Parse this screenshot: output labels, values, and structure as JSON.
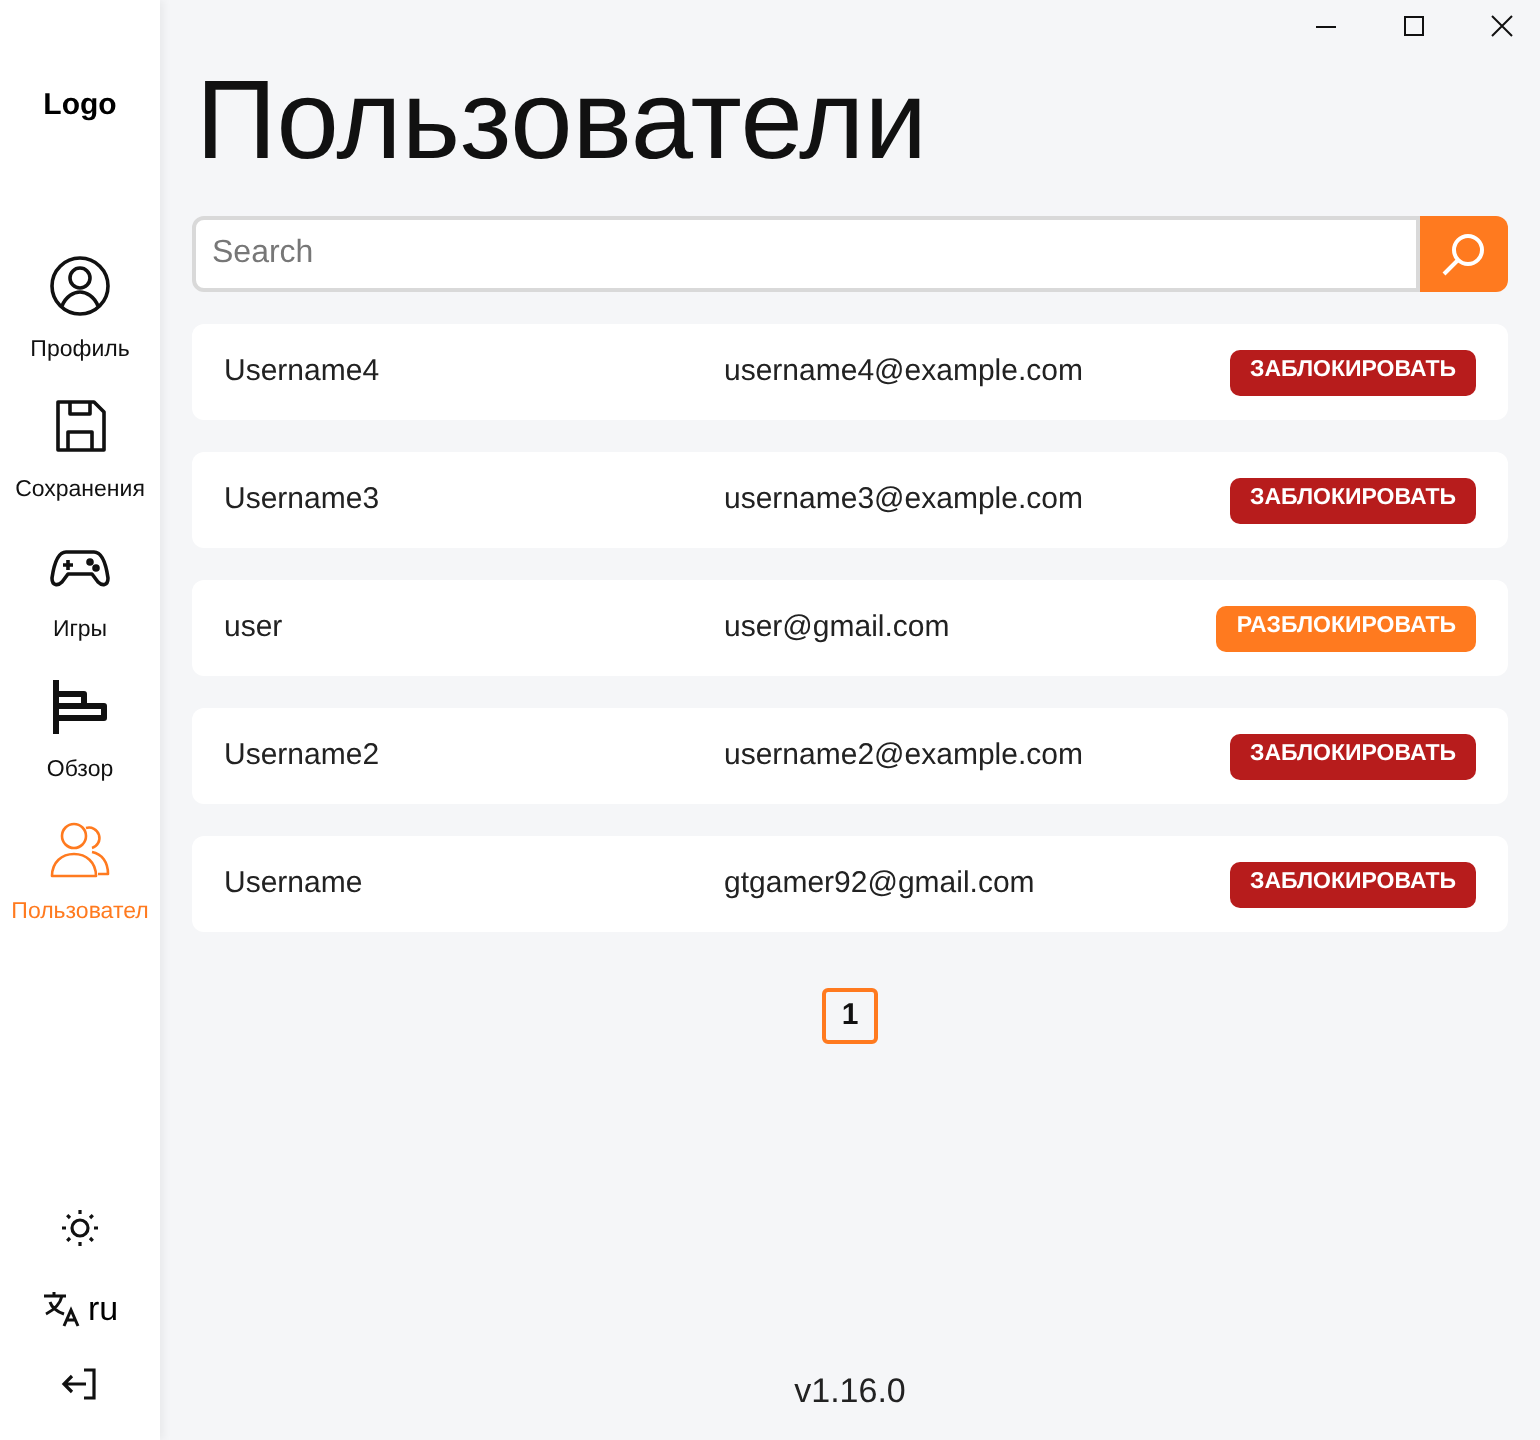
{
  "sidebar": {
    "logo": "Logo",
    "items": [
      {
        "kind": "profile",
        "label": "Профиль",
        "selected": false
      },
      {
        "kind": "saves",
        "label": "Сохранения",
        "selected": false
      },
      {
        "kind": "games",
        "label": "Игры",
        "selected": false
      },
      {
        "kind": "overview",
        "label": "Обзор",
        "selected": false
      },
      {
        "kind": "users",
        "label": "Пользовател",
        "selected": true
      }
    ],
    "language": "ru"
  },
  "title": "Пользователи",
  "search": {
    "placeholder": "Search"
  },
  "users": [
    {
      "username": "Username4",
      "email": "username4@example.com",
      "blocked": false,
      "action": "ЗАБЛОКИРОВАТЬ"
    },
    {
      "username": "Username3",
      "email": "username3@example.com",
      "blocked": false,
      "action": "ЗАБЛОКИРОВАТЬ"
    },
    {
      "username": "user",
      "email": "user@gmail.com",
      "blocked": true,
      "action": "РАЗБЛОКИРОВАТЬ"
    },
    {
      "username": "Username2",
      "email": "username2@example.com",
      "blocked": false,
      "action": "ЗАБЛОКИРОВАТЬ"
    },
    {
      "username": "Username",
      "email": "gtgamer92@gmail.com",
      "blocked": false,
      "action": "ЗАБЛОКИРОВАТЬ"
    }
  ],
  "pagination": [
    {
      "label": "1",
      "selected": true
    }
  ],
  "version": "v1.16.0"
}
